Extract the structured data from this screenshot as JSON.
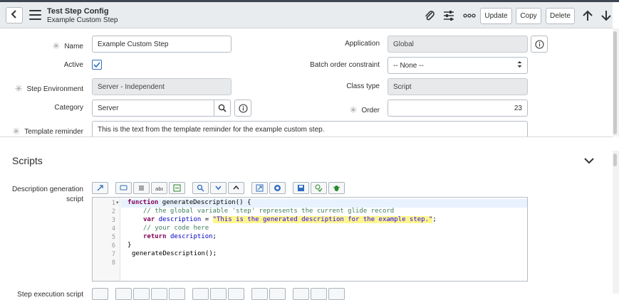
{
  "header": {
    "title": "Test Step Config",
    "subtitle": "Example Custom Step",
    "update_label": "Update",
    "copy_label": "Copy",
    "delete_label": "Delete"
  },
  "form": {
    "name_label": "Name",
    "name_value": "Example Custom Step",
    "active_label": "Active",
    "active_checked": true,
    "step_env_label": "Step Environment",
    "step_env_value": "Server - Independent",
    "category_label": "Category",
    "category_value": "Server",
    "template_label": "Template reminder",
    "template_value": "This is the text from the template reminder for the example custom step.",
    "application_label": "Application",
    "application_value": "Global",
    "batch_label": "Batch order constraint",
    "batch_value": "-- None --",
    "class_label": "Class type",
    "class_value": "Script",
    "order_label": "Order",
    "order_value": "23"
  },
  "scripts": {
    "title": "Scripts",
    "desc_label_line1": "Description generation",
    "desc_label_line2": "script",
    "second_label": "Step execution script",
    "line_numbers": [
      "1",
      "2",
      "3",
      "4",
      "5",
      "6",
      "7",
      "8"
    ],
    "code": {
      "l1_kw": "function",
      "l1_rest": " generateDescription() {",
      "l2": "// the global variable 'step' represents the current glide record",
      "l3_kw": "var",
      "l3_var": "description",
      "l3_eq": " = ",
      "l3_str": "\"This is the generated description for the example step.\"",
      "l3_end": ";",
      "l4": "// your code here",
      "l5_kw": "return",
      "l5_var": "description",
      "l5_end": ";",
      "l6": "}",
      "l7": "generateDescription();"
    }
  },
  "colors": {
    "accent": "#2f6ebd",
    "readonly": "#e7e9eb",
    "highlight": "#fdf68e"
  }
}
